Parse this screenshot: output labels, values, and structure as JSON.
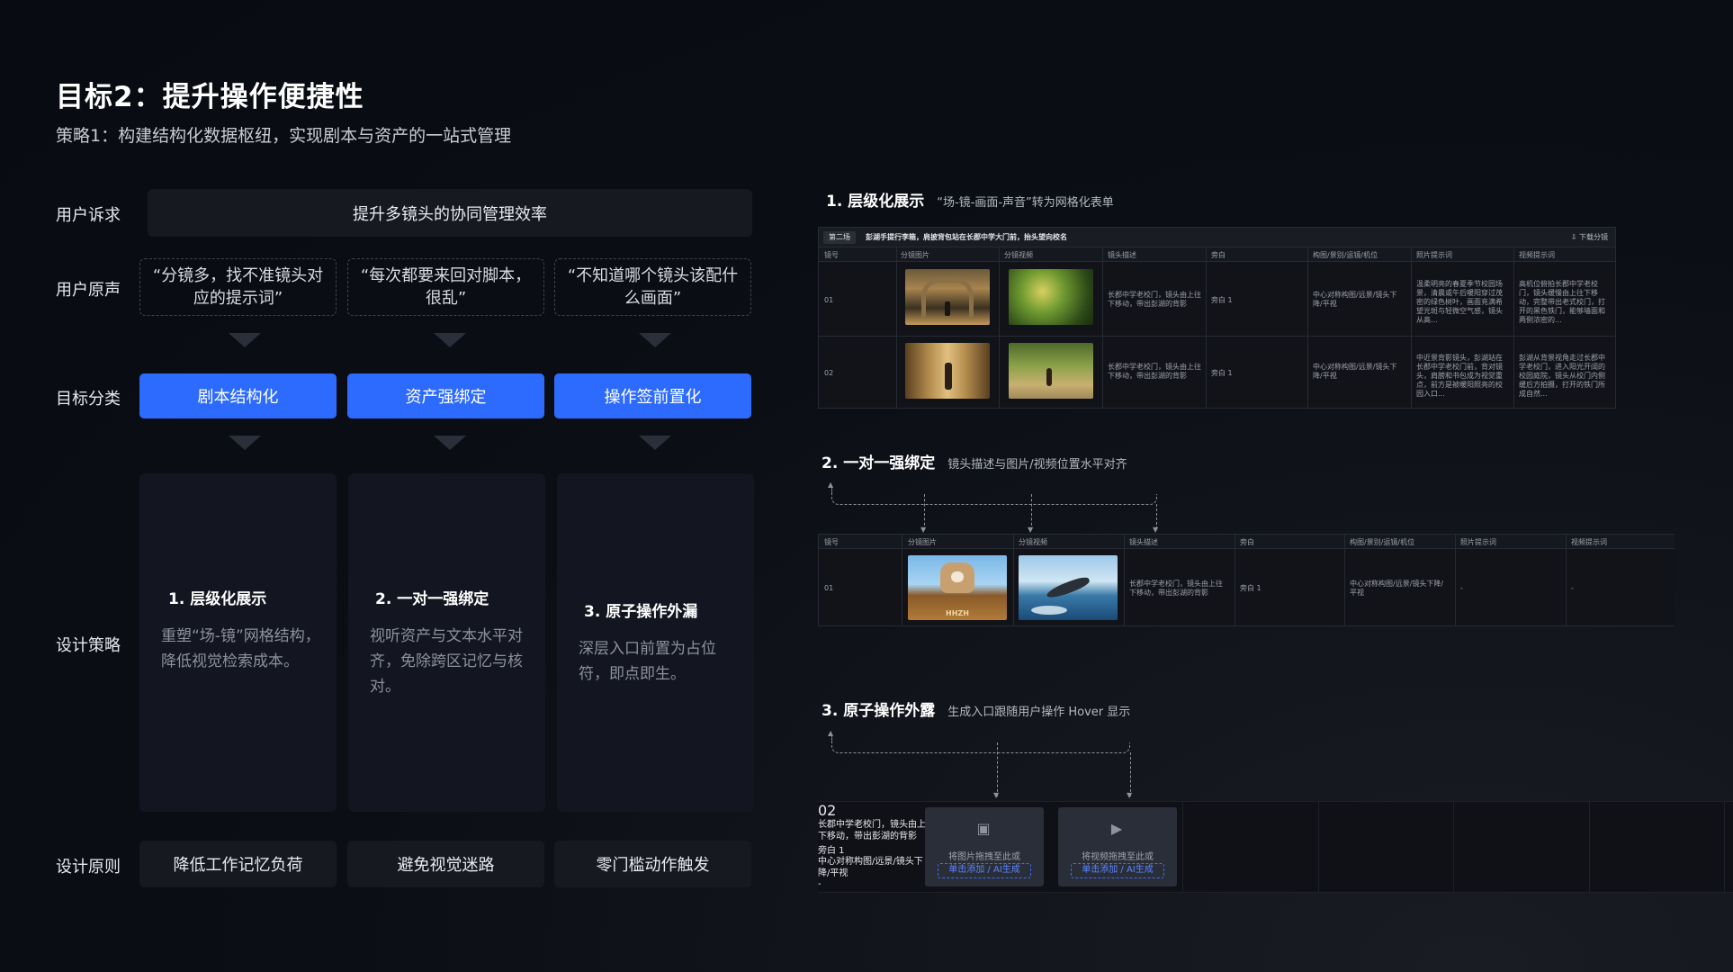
{
  "header": {
    "title": "目标2：提升操作便捷性",
    "subtitle": "策略1：构建结构化数据枢纽，实现剧本与资产的一站式管理"
  },
  "rows": {
    "need_label": "用户诉求",
    "voice_label": "用户原声",
    "goal_label": "目标分类",
    "strategy_label": "设计策略",
    "principle_label": "设计原则"
  },
  "need": "提升多镜头的协同管理效率",
  "voices": [
    "“分镜多，找不准镜头对应的提示词”",
    "“每次都要来回对脚本，很乱”",
    "“不知道哪个镜头该配什么画面”"
  ],
  "goals": [
    "剧本结构化",
    "资产强绑定",
    "操作签前置化"
  ],
  "strategies": [
    {
      "title": "1.  层级化展示",
      "desc": "重塑“场-镜”网格结构，降低视觉检索成本。"
    },
    {
      "title": "2. 一对一强绑定",
      "desc": "视听资产与文本水平对齐，免除跨区记忆与核对。"
    },
    {
      "title": "3. 原子操作外漏",
      "desc": "深层入口前置为占位符，即点即生。"
    }
  ],
  "principles": [
    "降低工作记忆负荷",
    "避免视觉迷路",
    "零门槛动作触发"
  ],
  "sections": [
    {
      "title": "1.  层级化展示",
      "desc": "“场-镜-画面-声音”转为网格化表单"
    },
    {
      "title": "2. 一对一强绑定",
      "desc": "镜头描述与图片/视频位置水平对齐"
    },
    {
      "title": "3. 原子操作外露",
      "desc": "生成入口跟随用户操作 Hover 显示"
    }
  ],
  "table1": {
    "scene_tag": "第二场",
    "scene_title": "彭湖手提行李箱，肩披背包站在长郡中学大门前，抬头望向校名",
    "download": "下载分镜",
    "headers": [
      "镜号",
      "分镜图片",
      "分镜视频",
      "镜头描述",
      "旁白",
      "构图/景别/运镜/机位",
      "照片提示词",
      "视频提示词"
    ],
    "rows": [
      {
        "no": "01",
        "desc": "长郡中学老校门，镜头由上往下移动，带出彭湖的背影",
        "narration": "旁白 1",
        "comp": "中心对称构图/远景/镜头下降/平视",
        "photo": "温柔明亮的春夏季节校园场景，清晨或午后暖阳穿过茂密的绿色树叶，画面充满希望光斑与轻微空气感，镜头从高...",
        "video": "高机位俯拍长郡中学老校门，镜头缓慢由上往下移动，完整带出老式校门，打开的黑色铁门，能够墙面和两侧浓密的..."
      },
      {
        "no": "02",
        "desc": "长郡中学老校门，镜头由上往下移动，带出彭湖的背影",
        "narration": "旁白 1",
        "comp": "中心对称构图/远景/镜头下降/平视",
        "photo": "中近景背影镜头，彭湖站在长郡中学老校门前，背对镜头，肩膀和书包成为视觉重点，前方是被暖阳照亮的校园入口...",
        "video": "彭湖从背景视角走过长郡中学老校门，进入阳光开阔的校园庭院，镜头从校门内侧缓后方拍摄，打开的铁门所成自然..."
      }
    ]
  },
  "table2": {
    "headers": [
      "镜号",
      "分镜图片",
      "分镜视频",
      "镜头描述",
      "旁白",
      "构图/景别/运镜/机位",
      "照片提示词",
      "视频提示词"
    ],
    "row": {
      "no": "01",
      "desc": "长郡中学老校门，镜头由上往下移动，带出彭湖的背影",
      "narration": "旁白 1",
      "comp": "中心对称构图/远景/镜头下降/平视",
      "photo": "-",
      "video": "-"
    },
    "sign_text": "HHZH"
  },
  "table3": {
    "row": {
      "no": "02",
      "desc": "长郡中学老校门，镜头由上往下移动，带出彭湖的背影",
      "narration": "旁白 1",
      "comp": "中心对称构图/远景/镜头下降/平视",
      "photo": "-"
    },
    "upload_image": {
      "label": "将图片拖拽至此或",
      "action": "单击添加  /  AI生成",
      "icon": "image-add-icon"
    },
    "upload_video": {
      "label": "将视频拖拽至此或",
      "action": "单击添加  /  AI生成",
      "icon": "play-icon"
    }
  },
  "colors": {
    "accent": "#2d6bff",
    "background": "#0a0d14",
    "card": "#131620"
  }
}
